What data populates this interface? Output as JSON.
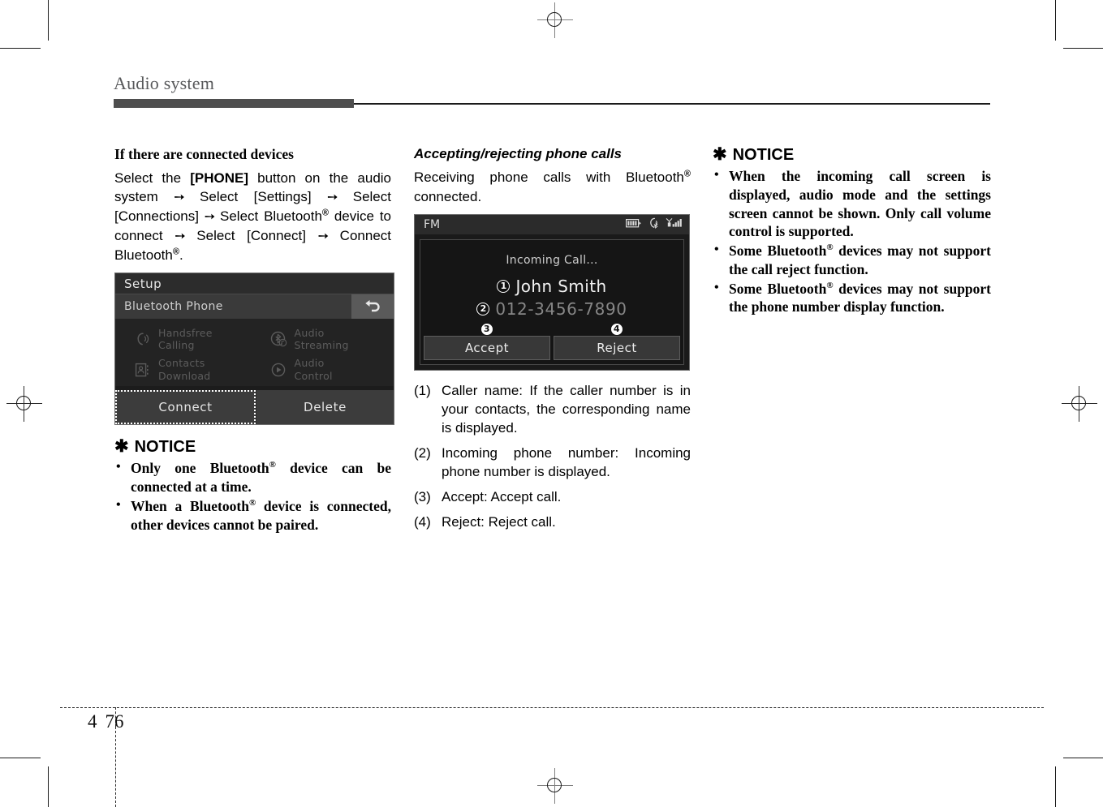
{
  "header": {
    "chapter_title": "Audio system"
  },
  "footer": {
    "chapter_number": "4",
    "page_number": "76"
  },
  "column1": {
    "sub_heading": "If there are connected devices",
    "paragraph": "Select the [PHONE] button on the audio system ➡ Select [Settings] ➡ Select [Connections] ➡ Select Bluetooth® device to connect ➡ Select [Connect] ➡ Connect Bluetooth®.",
    "setup_screen": {
      "title": "Setup",
      "sub_title": "Bluetooth Phone",
      "back_icon": "back-arrow-icon",
      "items": [
        {
          "label_line1": "Handsfree",
          "label_line2": "Calling",
          "icon": "handsfree-phone-icon"
        },
        {
          "label_line1": "Audio",
          "label_line2": "Streaming",
          "icon": "bluetooth-audio-icon"
        },
        {
          "label_line1": "Contacts",
          "label_line2": "Download",
          "icon": "contacts-book-icon"
        },
        {
          "label_line1": "Audio",
          "label_line2": "Control",
          "icon": "play-circle-icon"
        }
      ],
      "connect_label": "Connect",
      "delete_label": "Delete"
    },
    "notice": {
      "star": "✱",
      "title": "NOTICE",
      "items": [
        "Only one Bluetooth® device can be connected at a time.",
        "When a Bluetooth® device is connected, other devices cannot be paired."
      ]
    }
  },
  "column2": {
    "sub_heading": "Accepting/rejecting phone calls",
    "paragraph": "Receiving phone calls with Bluetooth® connected.",
    "call_screen": {
      "source": "FM",
      "status_icons": [
        "battery-icon",
        "phone-bluetooth-icon",
        "signal-strength-icon"
      ],
      "status_text": "Incoming Call...",
      "caller_name": "John Smith",
      "caller_number": "012-3456-7890",
      "badges": {
        "name": "1",
        "number": "2",
        "accept": "3",
        "reject": "4"
      },
      "accept_label": "Accept",
      "reject_label": "Reject"
    },
    "numbered_items": [
      {
        "label": "(1)",
        "text": "Caller name: If the caller number is in your contacts, the corresponding name is displayed."
      },
      {
        "label": "(2)",
        "text": "Incoming phone number: Incoming phone number is displayed."
      },
      {
        "label": "(3)",
        "text": "Accept: Accept call."
      },
      {
        "label": "(4)",
        "text": "Reject: Reject call."
      }
    ]
  },
  "column3": {
    "notice": {
      "star": "✱",
      "title": "NOTICE",
      "items": [
        "When the incoming call screen is displayed, audio mode and the settings screen cannot be shown. Only call volume control is supported.",
        "Some Bluetooth® devices may not support the call reject function.",
        "Some Bluetooth® devices may not support the phone number display function."
      ]
    }
  },
  "colors": {
    "header_bar": "#4e4e4e",
    "chapter_title": "#58595b",
    "screen_bg": "#1c1c1c",
    "screen_text": "#e8e8e8",
    "disabled_text": "#5c5c5c"
  }
}
